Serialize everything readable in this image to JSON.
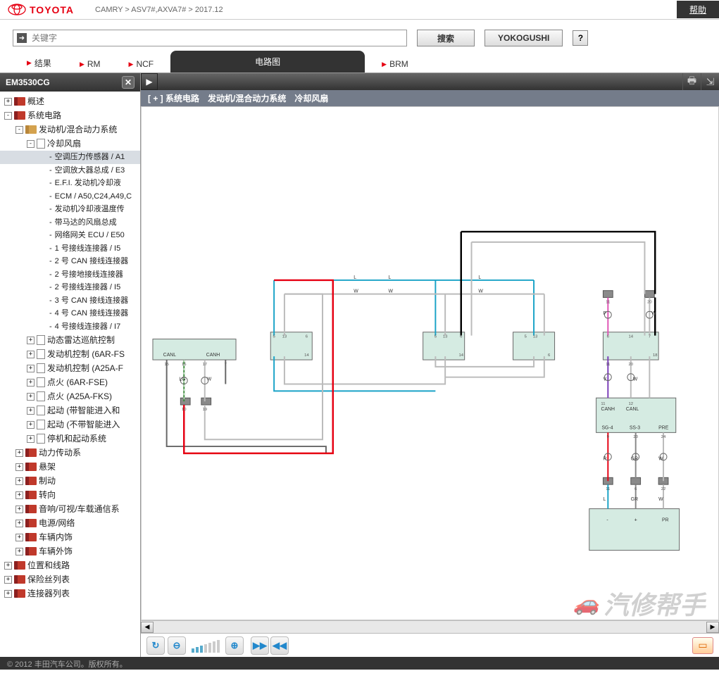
{
  "header": {
    "brand": "TOYOTA",
    "breadcrumb": "CAMRY > ASV7#,AXVA7# > 2017.12",
    "help": "帮助"
  },
  "search": {
    "placeholder": "关键字",
    "search_btn": "搜索",
    "yokogushi": "YOKOGUSHI",
    "q": "?"
  },
  "tabs": {
    "t1": "结果",
    "t2": "RM",
    "t3": "NCF",
    "active": "电路图",
    "t5": "BRM"
  },
  "sidebar": {
    "title": "EM3530CG",
    "nodes": {
      "overview": "概述",
      "sys_circuit": "系统电路",
      "engine_hybrid": "发动机/混合动力系统",
      "cooling_fan": "冷却风扇",
      "leaf1": "空调压力传感器 / A1",
      "leaf2": "空调放大器总成 / E3",
      "leaf3": "E.F.I. 发动机冷却液",
      "leaf4": "ECM / A50,C24,A49,C",
      "leaf5": "发动机冷却液温度传",
      "leaf6": "带马达的风扇总成",
      "leaf7": "网络网关 ECU / E50",
      "leaf8": "1 号接线连接器 / I5",
      "leaf9": "2 号 CAN 接线连接器",
      "leaf10": "2 号接地接线连接器",
      "leaf11": "2 号接线连接器 / I5",
      "leaf12": "3 号 CAN 接线连接器",
      "leaf13": "4 号 CAN 接线连接器",
      "leaf14": "4 号接线连接器 / I7",
      "dyn_radar": "动态雷达巡航控制",
      "eng_ctrl_6ar": "发动机控制 (6AR-FS",
      "eng_ctrl_a25a": "发动机控制 (A25A-F",
      "ign_6ar": "点火 (6AR-FSE)",
      "ign_a25a": "点火 (A25A-FKS)",
      "start_smart": "起动 (带智能进入和",
      "start_nosmart": "起动 (不带智能进入",
      "stop_start": "停机和起动系统",
      "powertrain": "动力传动系",
      "suspension": "悬架",
      "brake": "制动",
      "steering": "转向",
      "audio": "音响/可视/车载通信系",
      "power_net": "电源/网络",
      "interior": "车辆内饰",
      "exterior": "车辆外饰",
      "pos_route": "位置和线路",
      "fuse": "保险丝列表",
      "connector": "连接器列表"
    }
  },
  "content": {
    "title": "[ + ] 系统电路　发动机/混合动力系统　冷却风扇"
  },
  "diagram": {
    "labels": {
      "canl": "CANL",
      "canh": "CANH",
      "sg4": "SG-4",
      "ss3": "SS-3",
      "pre": "PRE",
      "pr": "PR",
      "w": "W",
      "l": "L",
      "lg": "LG",
      "gr": "GR",
      "r": "R",
      "v": "V",
      "p": "P"
    }
  },
  "footer": {
    "copyright": "© 2012 丰田汽车公司。版权所有。"
  },
  "watermark": "汽修帮手"
}
